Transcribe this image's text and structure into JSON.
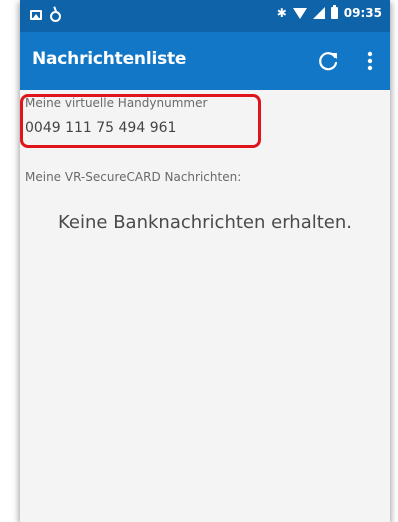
{
  "status_bar": {
    "time": "09:35",
    "icons": [
      "image-icon",
      "ring-icon",
      "bluetooth-icon",
      "wifi-icon",
      "signal-icon",
      "battery-icon"
    ],
    "background": "#0f63a8"
  },
  "app_bar": {
    "title": "Nachrichtenliste",
    "background": "#1277c6",
    "actions": [
      "refresh-icon",
      "more-vert-icon"
    ]
  },
  "virtual_number": {
    "label": "Meine virtuelle Handynummer",
    "value": "0049 111 75 494 961",
    "highlight_color": "#e0151b"
  },
  "messages": {
    "section_label": "Meine VR-SecureCARD Nachrichten:",
    "empty_text": "Keine Banknachrichten erhalten."
  }
}
